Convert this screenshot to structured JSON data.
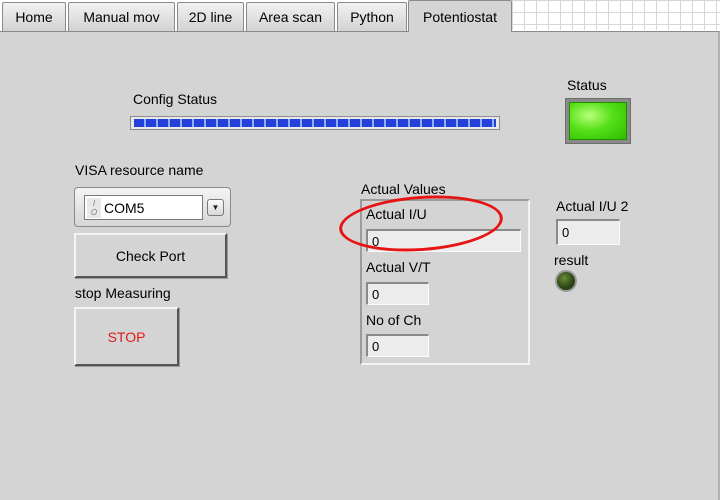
{
  "tabs": [
    "Home",
    "Manual mov",
    "2D line",
    "Area scan",
    "Python",
    "Potentiostat"
  ],
  "active_tab": "Potentiostat",
  "config_status": {
    "label": "Config Status",
    "progress": 1.0
  },
  "status": {
    "label": "Status",
    "color": "#55e018",
    "state": "on"
  },
  "visa": {
    "label": "VISA resource name",
    "value": "COM5",
    "icon": "io-resource-icon"
  },
  "check_port_label": "Check Port",
  "stop_measuring_label": "stop Measuring",
  "stop_button_label": "STOP",
  "actual_values": {
    "label": "Actual Values",
    "fields": [
      {
        "label": "Actual I/U",
        "value": "0"
      },
      {
        "label": "Actual V/T",
        "value": "0"
      },
      {
        "label": "No of Ch",
        "value": "0"
      }
    ]
  },
  "actual_iu2": {
    "label": "Actual I/U 2",
    "value": "0"
  },
  "result": {
    "label": "result",
    "state": "off"
  },
  "annotation": {
    "color": "#e61414",
    "shape": "ellipse-highlight"
  }
}
